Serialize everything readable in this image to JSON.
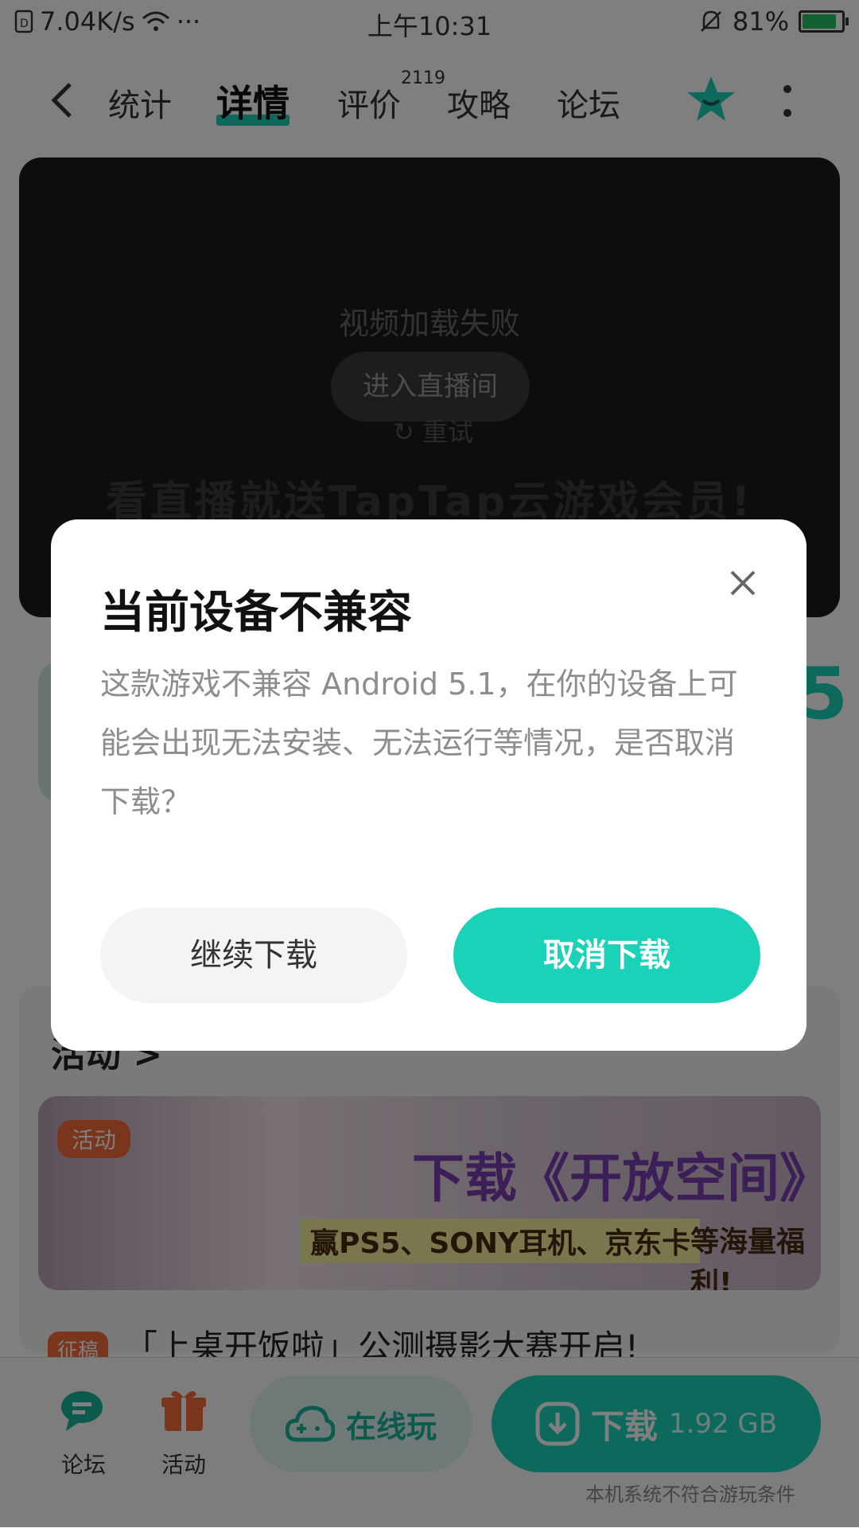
{
  "status_bar": {
    "speed": "7.04K/s",
    "dots": "···",
    "time": "上午10:31",
    "battery_percent": "81%",
    "battery_level": 0.81,
    "icons": [
      "sim-icon",
      "wifi-icon",
      "bell-off-icon",
      "battery-charging-icon"
    ]
  },
  "nav": {
    "tabs": [
      {
        "label": "统计"
      },
      {
        "label": "详情"
      },
      {
        "label": "评价"
      },
      {
        "label": "攻略"
      },
      {
        "label": "论坛"
      }
    ],
    "active_tab": "详情",
    "review_count": "2119"
  },
  "video": {
    "message": "视频加载失败",
    "live_button": "进入直播间",
    "retry": "重试",
    "banner": "看直播就送TapTap云游戏会员!"
  },
  "section": {
    "title": "活动 >"
  },
  "event": {
    "tag": "活动",
    "headline": "下载《开放空间》",
    "prizes": "赢PS5、SONY耳机、京东卡",
    "tail": "等海量福利!"
  },
  "news": {
    "tag": "征稿",
    "text": "「上桌开饭啦」公测摄影大赛开启!"
  },
  "bottom_bar": {
    "forum": "论坛",
    "activity": "活动",
    "play_online": "在线玩",
    "download": "下载",
    "download_size": "1.92 GB",
    "note": "本机系统不符合游玩条件"
  },
  "dialog": {
    "title": "当前设备不兼容",
    "body": "这款游戏不兼容 Android 5.1，在你的设备上可能会出现无法安装、无法运行等情况，是否取消下载？",
    "continue_label": "继续下载",
    "cancel_label": "取消下载"
  },
  "colors": {
    "accent": "#19d2b7",
    "overlay": "rgba(0,0,0,0.5)"
  }
}
